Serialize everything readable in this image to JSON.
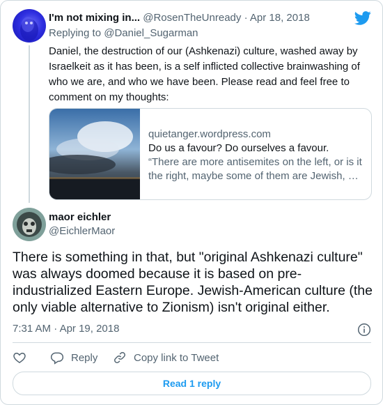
{
  "parent_tweet": {
    "name": "I'm not mixing in...",
    "handle": "@RosenTheUnready",
    "date": "Apr 18, 2018",
    "separator": "·",
    "replying_to_prefix": "Replying to ",
    "replying_to_handle": "@Daniel_Sugarman",
    "text": "Daniel, the destruction of our (Ashkenazi) culture, washed away by Israelkeit as it has been, is a self inflicted collective brainwashing of who we are, and who we have been. Please read and feel free to comment on my thoughts:",
    "link_card": {
      "domain": "quietanger.wordpress.com",
      "title": "Do us a favour? Do ourselves a favour.",
      "description_line1": "“There are more antisemites on the left, or is it",
      "description_line2": "the right, maybe some of them are Jewish, …"
    }
  },
  "main_tweet": {
    "name": "maor eichler",
    "handle": "@EichlerMaor",
    "text": "There is something in that, but \"original Ashkenazi culture\" was always doomed because it is based on pre-industrialized Eastern Europe. Jewish-American culture (the only viable alternative to Zionism) isn't original either.",
    "time": "7:31 AM",
    "separator": "·",
    "date": "Apr 19, 2018"
  },
  "actions": {
    "like_icon": "heart-icon",
    "reply_label": "Reply",
    "copy_link_label": "Copy link to Tweet"
  },
  "read_replies_label": "Read 1 reply",
  "colors": {
    "accent": "#1d9bf0",
    "text": "#0f1419",
    "muted": "#536471",
    "border": "#cfd9de"
  }
}
